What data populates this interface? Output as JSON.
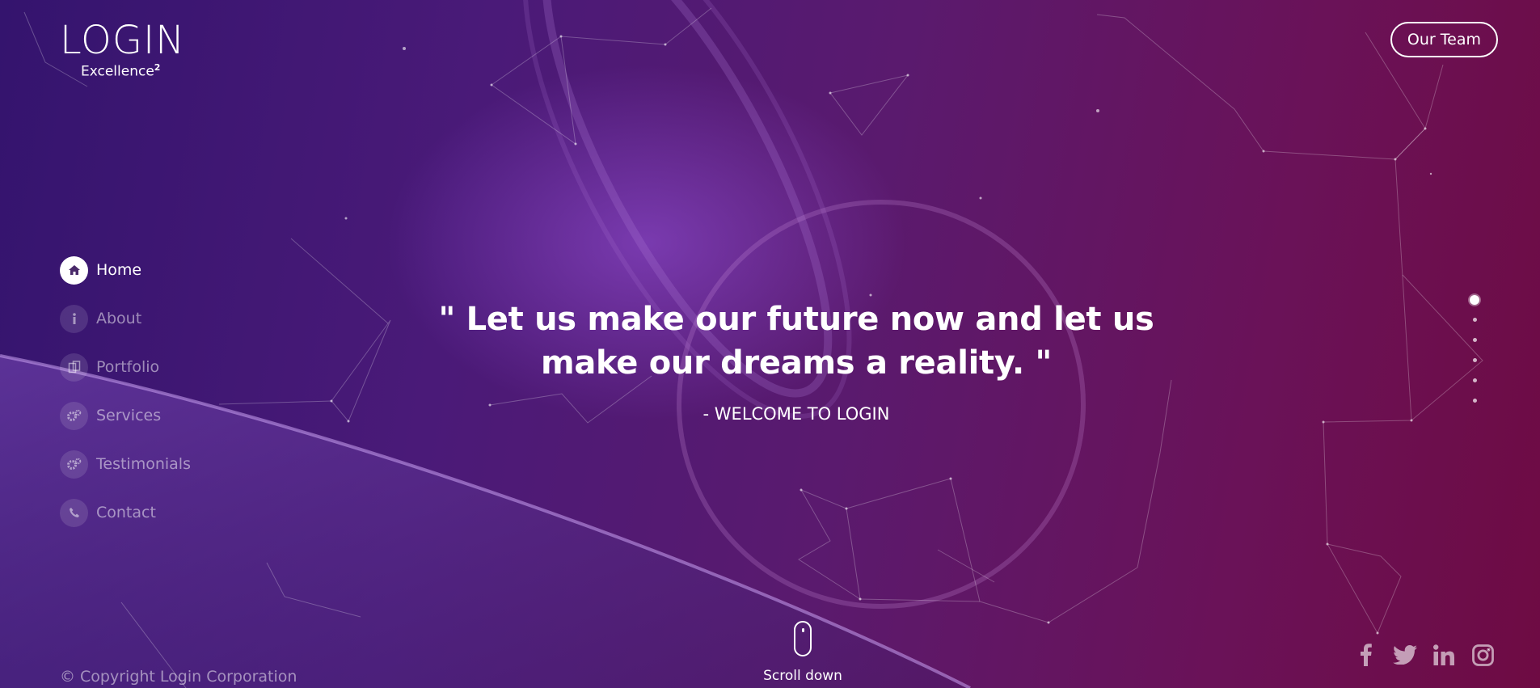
{
  "logo": {
    "title": "LOGIN",
    "subtitle": "Excellence",
    "superscript": "2"
  },
  "header": {
    "team_button": "Our Team"
  },
  "nav": {
    "items": [
      {
        "label": "Home",
        "icon": "home-icon",
        "active": true
      },
      {
        "label": "About",
        "icon": "info-icon"
      },
      {
        "label": "Portfolio",
        "icon": "portfolio-icon"
      },
      {
        "label": "Services",
        "icon": "gears-icon"
      },
      {
        "label": "Testimonials",
        "icon": "gears-icon"
      },
      {
        "label": "Contact",
        "icon": "phone-icon"
      }
    ]
  },
  "hero": {
    "quote": "\" Let us make our future now and let us make our dreams a reality. \"",
    "subline": "- WELCOME TO LOGIN"
  },
  "pagination": {
    "count": 6,
    "active": 1
  },
  "scroll": {
    "label": "Scroll down"
  },
  "footer": {
    "copyright": "© Copyright Login Corporation",
    "social": [
      "facebook-icon",
      "twitter-icon",
      "linkedin-icon",
      "instagram-icon"
    ]
  },
  "colors": {
    "bg_left": "#34146e",
    "bg_right": "#6e0b43",
    "text": "#ffffff"
  }
}
